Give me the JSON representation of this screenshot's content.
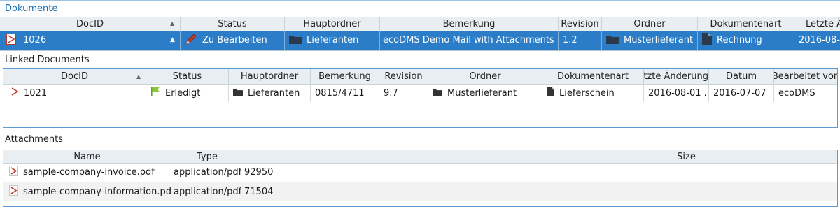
{
  "dokumente": {
    "title": "Dokumente",
    "columns": [
      "DocID",
      "Status",
      "Hauptordner",
      "Bemerkung",
      "Revision",
      "Ordner",
      "Dokumentenart",
      "Letzte Ä"
    ],
    "row": {
      "docid": "1026",
      "status": "Zu Bearbeiten",
      "hauptordner": "Lieferanten",
      "bemerkung": "ecoDMS Demo Mail with Attachments",
      "revision": "1.2",
      "ordner": "Musterlieferant",
      "dokumentenart": "Rechnung",
      "letzte_aenderung": "2016-08-0"
    }
  },
  "linked": {
    "title": "Linked Documents",
    "columns": [
      "DocID",
      "Status",
      "Hauptordner",
      "Bemerkung",
      "Revision",
      "Ordner",
      "Dokumentenart",
      "Letzte Änderung",
      "Datum",
      "Bearbeitet von"
    ],
    "row": {
      "docid": "1021",
      "status": "Erledigt",
      "hauptordner": "Lieferanten",
      "bemerkung": "0815/4711",
      "revision": "9.7",
      "ordner": "Musterlieferant",
      "dokumentenart": "Lieferschein",
      "letzte_aenderung": "2016-08-01 ...",
      "datum": "2016-07-07",
      "bearbeitet_von": "ecoDMS"
    }
  },
  "attachments": {
    "title": "Attachments",
    "columns": [
      "Name",
      "Type",
      "Size"
    ],
    "rows": [
      {
        "name": "sample-company-invoice.pdf",
        "type": "application/pdf",
        "size": "92950"
      },
      {
        "name": "sample-company-information.pdf",
        "type": "application/pdf",
        "size": "71504"
      }
    ]
  },
  "colors": {
    "title_blue": "#1a6fb0",
    "selection": "#2b7dc8",
    "header_bg": "#e9eef2",
    "status_green": "#8cc63f",
    "pen_red": "#c0392b"
  },
  "icons": {
    "pdf": "pdf-icon",
    "folder": "folder-icon",
    "document": "document-icon",
    "pen": "pen-icon",
    "flag": "flag-icon",
    "sort": "sort-ascending-icon"
  }
}
